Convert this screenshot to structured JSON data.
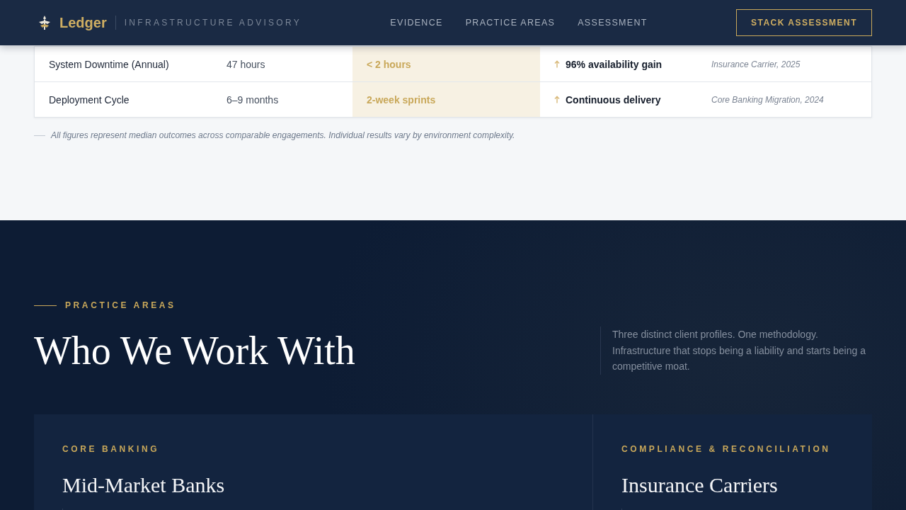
{
  "header": {
    "brand": "Ledger",
    "tagline": "INFRASTRUCTURE ADVISORY",
    "nav": [
      "EVIDENCE",
      "PRACTICE AREAS",
      "ASSESSMENT"
    ],
    "cta": "STACK ASSESSMENT"
  },
  "results_table": {
    "columns": [
      {
        "kind": "label"
      },
      {
        "kind": "plain"
      },
      {
        "kind": "highlight"
      },
      {
        "kind": "trend"
      },
      {
        "kind": "citation"
      }
    ],
    "rows": [
      {
        "cells": [
          "System Downtime (Annual)",
          "47 hours",
          "< 2 hours",
          "96% availability gain",
          "Insurance Carrier, 2025"
        ]
      },
      {
        "cells": [
          "Deployment Cycle",
          "6–9 months",
          "2-week sprints",
          "Continuous delivery",
          "Core Banking Migration, 2024"
        ]
      }
    ]
  },
  "footnote": "All figures represent median outcomes across comparable engagements. Individual results vary by environment complexity.",
  "practice_areas": {
    "eyebrow": "PRACTICE AREAS",
    "heading": "Who We Work With",
    "intro": "Three distinct client profiles. One methodology. Infrastructure that stops being a liability and starts being a competitive moat.",
    "cards": [
      {
        "eyebrow": "CORE BANKING",
        "title": "Mid-Market Banks"
      },
      {
        "eyebrow": "COMPLIANCE & RECONCILIATION",
        "title": "Insurance Carriers"
      }
    ]
  }
}
